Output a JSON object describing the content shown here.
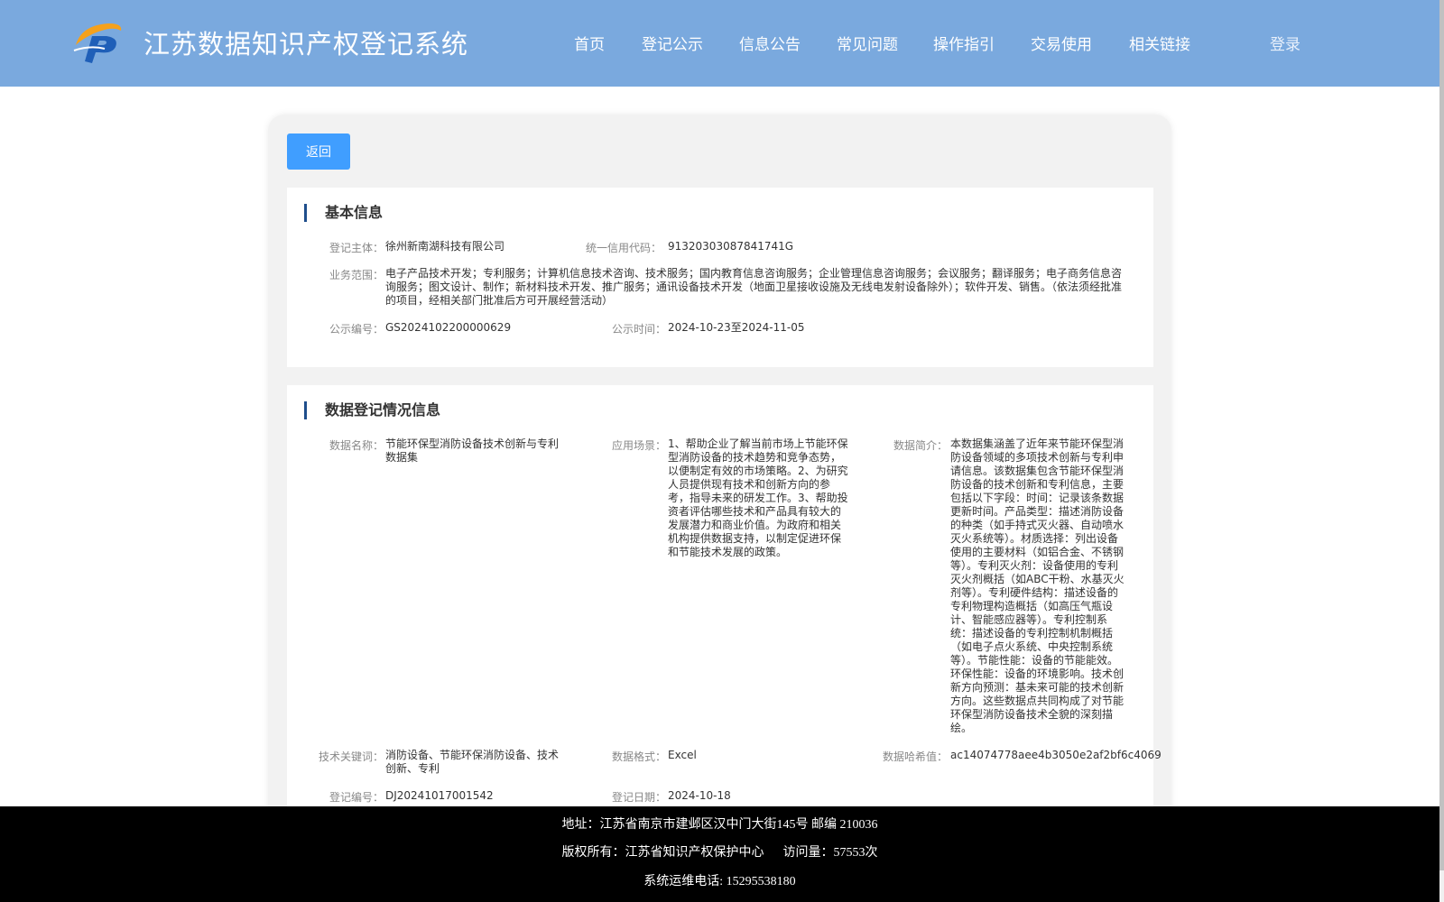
{
  "header": {
    "site_title": "江苏数据知识产权登记系统",
    "nav": [
      "首页",
      "登记公示",
      "信息公告",
      "常见问题",
      "操作指引",
      "交易使用",
      "相关链接"
    ],
    "login": "登录"
  },
  "back_label": "返回",
  "basic": {
    "title": "基本信息",
    "subject_label": "登记主体：",
    "subject_value": "徐州新南湖科技有限公司",
    "credit_label": "统一信用代码：",
    "credit_value": "91320303087841741G",
    "scope_label": "业务范围：",
    "scope_value": "电子产品技术开发；专利服务；计算机信息技术咨询、技术服务；国内教育信息咨询服务；企业管理信息咨询服务；会议服务；翻译服务；电子商务信息咨询服务；图文设计、制作；新材料技术开发、推广服务；通讯设备技术开发（地面卫星接收设施及无线电发射设备除外）；软件开发、销售。（依法须经批准的项目，经相关部门批准后方可开展经营活动）",
    "pub_no_label": "公示编号：",
    "pub_no_value": "GS2024102200000629",
    "pub_time_label": "公示时间：",
    "pub_time_value": "2024-10-23至2024-11-05"
  },
  "data_reg": {
    "title": "数据登记情况信息",
    "name_label": "数据名称：",
    "name_value": "节能环保型消防设备技术创新与专利数据集",
    "scene_label": "应用场景：",
    "scene_value": "1、帮助企业了解当前市场上节能环保型消防设备的技术趋势和竞争态势，以便制定有效的市场策略。2、为研究人员提供现有技术和创新方向的参考，指导未来的研发工作。3、帮助投资者评估哪些技术和产品具有较大的发展潜力和商业价值。为政府和相关机构提供数据支持，以制定促进环保和节能技术发展的政策。",
    "intro_label": "数据简介：",
    "intro_value": "本数据集涵盖了近年来节能环保型消防设备领域的多项技术创新与专利申请信息。该数据集包含节能环保型消防设备的技术创新和专利信息，主要包括以下字段：时间：记录该条数据更新时间。产品类型：描述消防设备的种类（如手持式灭火器、自动喷水灭火系统等）。材质选择：列出设备使用的主要材料（如铝合金、不锈钢等）。专利灭火剂：设备使用的专利灭火剂概括（如ABC干粉、水基灭火剂等）。专利硬件结构：描述设备的专利物理构造概括（如高压气瓶设计、智能感应器等）。专利控制系统：描述设备的专利控制机制概括（如电子点火系统、中央控制系统等）。节能性能：设备的节能能效。环保性能：设备的环境影响。技术创新方向预测：基未来可能的技术创新方向。这些数据点共同构成了对节能环保型消防设备技术全貌的深刻描绘。",
    "keywords_label": "技术关键词：",
    "keywords_value": "消防设备、节能环保消防设备、技术创新、专利",
    "format_label": "数据格式：",
    "format_value": "Excel",
    "hash_label": "数据哈希值：",
    "hash_value": "ac14074778aee4b3050e2af2bf6c4069",
    "reg_no_label": "登记编号：",
    "reg_no_value": "DJ20241017001542",
    "reg_date_label": "登记日期：",
    "reg_date_value": "2024-10-18"
  },
  "footer": {
    "address": "地址：江苏省南京市建邺区汉中门大街145号 邮编 210036",
    "copyright": "版权所有：江苏省知识产权保护中心      访问量：57553次",
    "phone": "系统运维电话: 15295538180"
  },
  "colors": {
    "header_bg": "#7aa9de",
    "button": "#409eff",
    "title_bar": "#1f4e8c",
    "footer_bg": "#000000"
  }
}
